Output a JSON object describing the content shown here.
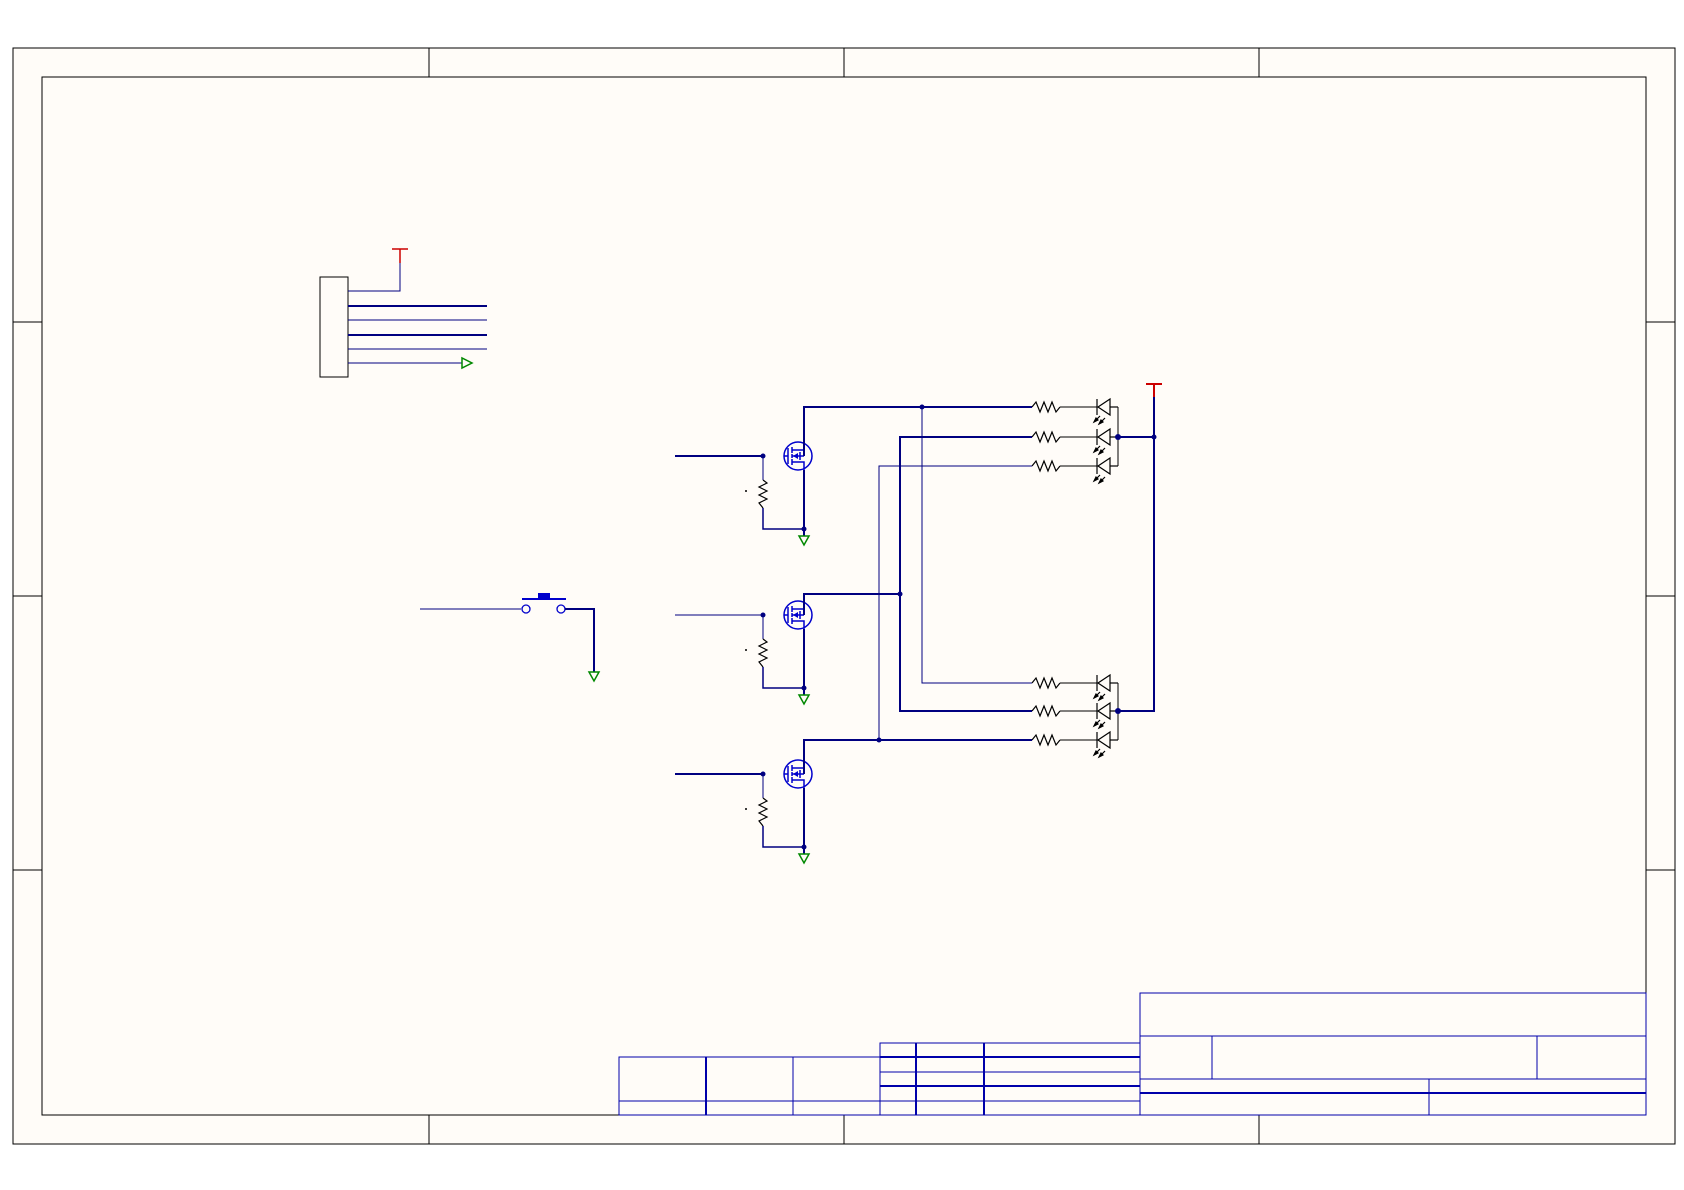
{
  "colors": {
    "page": "#ffffff",
    "sheet": "#fffcf8",
    "frame": "#000000",
    "wire": "#000080",
    "component": "#0000cc",
    "power": "#cc0000",
    "ground": "#008800",
    "title_block": "#0000aa"
  },
  "icons": {
    "power": "power-symbol-icon",
    "ground": "ground-symbol-icon",
    "mosfet": "n-mosfet-icon",
    "resistor": "resistor-icon",
    "led": "led-icon",
    "button": "push-button-icon",
    "connector": "connector-header-icon"
  },
  "schematic": {
    "mosfet_count": 3,
    "led_channel_count": 6,
    "connector_pin_count": 6
  }
}
